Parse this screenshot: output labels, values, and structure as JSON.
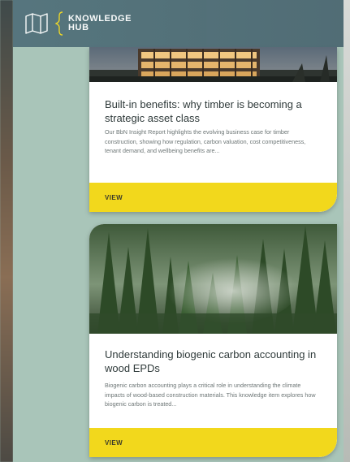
{
  "header": {
    "logo_line1": "KNOWLEDGE",
    "logo_line2": "HUB"
  },
  "cards": [
    {
      "title": "Built-in benefits: why timber is becoming a strategic asset class",
      "description": "Our BbN Insight Report highlights the evolving business case for timber construction, showing how regulation, carbon valuation, cost competitiveness, tenant demand, and wellbeing benefits are...",
      "link_label": "VIEW",
      "image_icon": "timber-building-photo"
    },
    {
      "title": "Understanding biogenic carbon accounting in wood EPDs",
      "description": "Biogenic carbon accounting plays a critical role in understanding the climate impacts of wood-based construction materials. This knowledge item explores how biogenic carbon is treated...",
      "link_label": "VIEW",
      "image_icon": "misty-forest-photo"
    }
  ],
  "colors": {
    "background": "#a9c5b9",
    "header": "#4a6670",
    "accent_yellow": "#f2d81c"
  }
}
